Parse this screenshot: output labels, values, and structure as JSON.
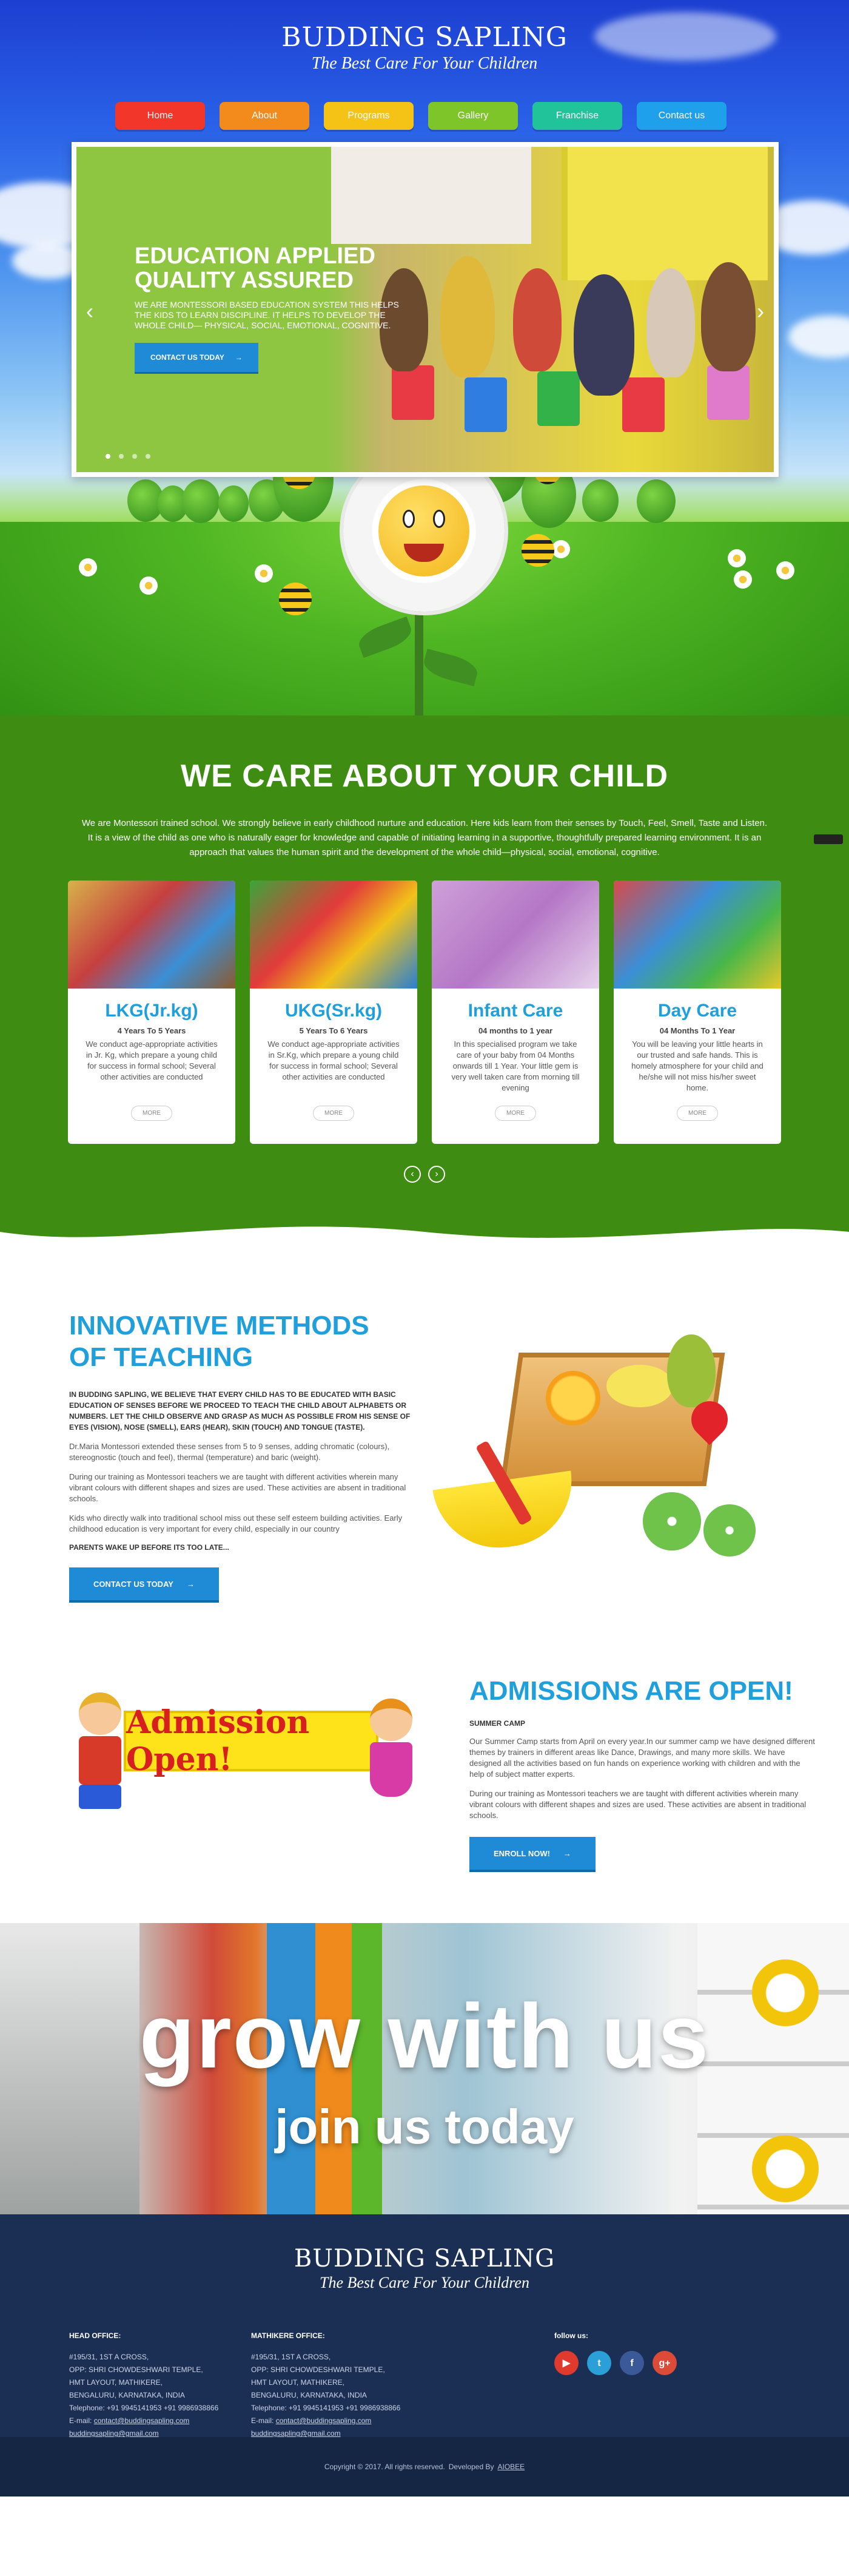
{
  "brand": {
    "title": "BUDDING SAPLING",
    "tagline": "The Best Care For Your Children"
  },
  "nav": [
    {
      "label": "Home",
      "color": "#f2362a"
    },
    {
      "label": "About",
      "color": "#f28a1c"
    },
    {
      "label": "Programs",
      "color": "#f4c316"
    },
    {
      "label": "Gallery",
      "color": "#7ec52a"
    },
    {
      "label": "Franchise",
      "color": "#20c39a"
    },
    {
      "label": "Contact us",
      "color": "#1ea0ea"
    }
  ],
  "slider": {
    "title_line1": "EDUCATION APPLIED",
    "title_line2": "QUALITY ASSURED",
    "desc": "We are Montessori based education system This helps the kids to learn discipline. It helps to develop the whole child— physical, social, emotional, cognitive.",
    "button": "CONTACT US TODAY",
    "prev_icon": "‹",
    "next_icon": "›",
    "dot_count": 4,
    "active_dot": 1
  },
  "care": {
    "title": "WE CARE ABOUT YOUR CHILD",
    "desc": "We are Montessori trained school. We strongly believe in early childhood nurture and education. Here kids learn from their senses by Touch, Feel, Smell, Taste and Listen. It is a view of the child as one who is naturally eager for knowledge and capable of initiating learning in a supportive, thoughtfully prepared learning environment. It is an approach that values the human spirit and the development of the whole child—physical, social, emotional, cognitive.",
    "cards": [
      {
        "title": "LKG(Jr.kg)",
        "sub": "4 Years To 5 Years",
        "text": "We conduct age-appropriate activities in Jr. Kg, which prepare a young child for success in formal school; Several other activities are conducted",
        "more": "MORE"
      },
      {
        "title": "UKG(Sr.kg)",
        "sub": "5 Years To 6 Years",
        "text": "We conduct age-appropriate activities in Sr.Kg, which prepare a young child for success in formal school; Several other activities are conducted",
        "more": "MORE"
      },
      {
        "title": "Infant Care",
        "sub": "04 months to 1 year",
        "text": "In this specialised program we take care of your baby from 04 Months onwards till 1 Year. Your little gem is very well taken care from morning till evening",
        "more": "MORE"
      },
      {
        "title": "Day Care",
        "sub": "04 Months To 1 Year",
        "text": "You will be leaving your little hearts in our trusted and safe hands. This is homely atmosphere for your child and he/she will not miss his/her sweet home.",
        "more": "MORE"
      }
    ],
    "prev_icon": "‹",
    "next_icon": "›"
  },
  "innovative": {
    "title_line1": "INNOVATIVE METHODS",
    "title_line2": "OF TEACHING",
    "lead": "In Budding Sapling, we believe that every child has to be educated with basic education of senses before we proceed to teach the child about alphabets or numbers. Let the child observe and grasp as much as possible from his sense of Eyes (Vision), Nose (Smell), Ears (Hear), Skin (Touch) and Tongue (Taste).",
    "p1": "Dr.Maria Montessori extended these senses from 5 to 9 senses, adding chromatic (colours), stereognostic (touch and feel), thermal (temperature) and baric (weight).",
    "p2": "During our training as Montessori teachers we are taught with different activities wherein many vibrant colours with different shapes and sizes are used. These activities are absent in traditional schools.",
    "p3": "Kids who directly walk into traditional school miss out these self esteem building activities. Early childhood education is very important for every child, especially in our country",
    "warn": "PARENTS WAKE UP BEFORE ITS TOO LATE...",
    "button": "CONTACT US TODAY"
  },
  "admission": {
    "banner": "Admission Open!",
    "title": "ADMISSIONS ARE OPEN!",
    "sub": "SUMMER CAMP",
    "p1": "Our Summer Camp starts from April on every year.In our summer camp we have designed different themes by trainers in different areas like Dance, Drawings, and many more skills. We have designed all the activities based on fun hands on experience working with children and with the help of subject matter experts.",
    "p2": "During our training as Montessori teachers we are taught with different activities wherein many vibrant colours with different shapes and sizes are used. These activities are absent in traditional schools.",
    "button": "ENROLL NOW!"
  },
  "grow": {
    "line1": "grow with us",
    "line2": "join us today"
  },
  "footer": {
    "head_office": {
      "heading": "HEAD OFFICE:",
      "lines": [
        "#195/31, 1ST A CROSS,",
        "OPP: SHRI CHOWDESHWARI TEMPLE,",
        "HMT LAYOUT, MATHIKERE,",
        "BENGALURU, KARNATAKA, INDIA",
        "Telephone: +91 9945141953  +91 9986938866"
      ],
      "email_label": "E-mail:",
      "email1": "contact@buddingsapling.com",
      "email2": "buddingsapling@gmail.com"
    },
    "mathikere_office": {
      "heading": "MATHIKERE OFFICE:",
      "lines": [
        "#195/31, 1ST A CROSS,",
        "OPP: SHRI CHOWDESHWARI TEMPLE,",
        "HMT LAYOUT, MATHIKERE,",
        "BENGALURU, KARNATAKA, INDIA",
        "Telephone: +91 9945141953  +91 9986938866"
      ],
      "email_label": "E-mail:",
      "email1": "contact@buddingsapling.com",
      "email2": "buddingsapling@gmail.com"
    },
    "follow": {
      "heading": "follow us:",
      "icons": [
        {
          "name": "youtube-icon",
          "glyph": "▶",
          "color": "#e03a2e"
        },
        {
          "name": "twitter-icon",
          "glyph": "t",
          "color": "#2a9fd8"
        },
        {
          "name": "facebook-icon",
          "glyph": "f",
          "color": "#3b5998"
        },
        {
          "name": "google-plus-icon",
          "glyph": "g+",
          "color": "#dc4a38"
        }
      ]
    },
    "copyright": "Copyright © 2017. All rights reserved.",
    "developed_by": "Developed By",
    "developer": "AIOBEE"
  }
}
